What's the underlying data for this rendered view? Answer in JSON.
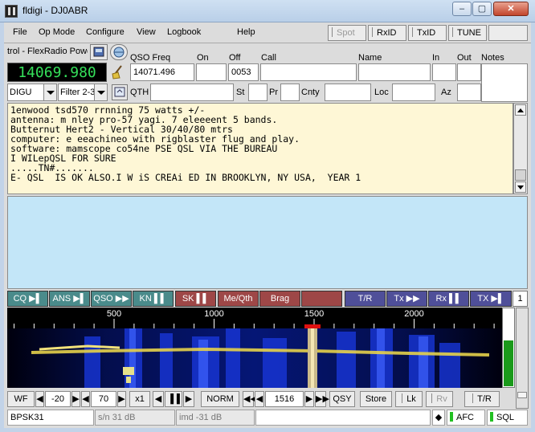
{
  "window": {
    "title": "fldigi - DJ0ABR",
    "minimize": "–",
    "maximize": "▢",
    "close": "✕"
  },
  "menu": {
    "file": "File",
    "opmode": "Op Mode",
    "configure": "Configure",
    "view": "View",
    "logbook": "Logbook",
    "help": "Help",
    "spot": "Spot",
    "rxid": "RxID",
    "txid": "TxID",
    "tune": "TUNE"
  },
  "rig": {
    "name": "trol - FlexRadio Powe",
    "frequency": "14069.980",
    "mode": "DIGU",
    "filter": "Filter 2-3"
  },
  "log": {
    "qso_freq_label": "QSO Freq",
    "qso_freq": "14071.496",
    "on_label": "On",
    "on": "",
    "off_label": "Off",
    "off": "0053",
    "call_label": "Call",
    "call": "",
    "name_label": "Name",
    "name": "",
    "in_label": "In",
    "in": "",
    "out_label": "Out",
    "out": "",
    "notes_label": "Notes",
    "notes": "",
    "qth_label": "QTH",
    "qth": "",
    "st_label": "St",
    "st": "",
    "pr_label": "Pr",
    "pr": "",
    "cnty_label": "Cnty",
    "cnty": "",
    "loc_label": "Loc",
    "loc": "",
    "az_label": "Az",
    "az": ""
  },
  "rx_text": "1enwood tsd570 rrnning 75 watts +/-\nantenna: m nley pro-57 yagi. 7 eleeeent 5 bands.\nButternut Hert2 - Vertical 30/40/80 mtrs\ncomputer: e eeachineo with rigblaster flug and play.\nsoftware: mamscope co54ne PSE QSL VIA THE BUREAU\nI WILepQSL FOR SURE\n.....TN#.......\nE- QSL  IS OK ALSO.I W iS CREAi ED IN BROOKLYN, NY USA,  YEAR 1",
  "tx_text": "",
  "macros": [
    {
      "label": "CQ ▶▌",
      "color": "teal"
    },
    {
      "label": "ANS ▶▌",
      "color": "teal"
    },
    {
      "label": "QSO ▶▶",
      "color": "teal"
    },
    {
      "label": "KN ▌▌",
      "color": "teal"
    },
    {
      "label": "SK ▌▌",
      "color": "red"
    },
    {
      "label": "Me/Qth",
      "color": "red"
    },
    {
      "label": "Brag",
      "color": "red"
    },
    {
      "label": "",
      "color": "red"
    },
    {
      "label": "T/R",
      "color": "blue"
    },
    {
      "label": "Tx ▶▶",
      "color": "blue"
    },
    {
      "label": "Rx ▌▌",
      "color": "blue"
    },
    {
      "label": "TX ▶▌",
      "color": "blue"
    }
  ],
  "macro_page": "1",
  "waterfall": {
    "scale_labels": [
      "500",
      "1000",
      "1500",
      "2000"
    ],
    "signal_level": 0.58
  },
  "controls": {
    "wf": "WF",
    "offset": "-20",
    "range": "70",
    "zoom": "x1",
    "pause": "▐▐",
    "norm": "NORM",
    "freq": "1516",
    "qsy": "QSY",
    "store": "Store",
    "lk": "Lk",
    "rv": "Rv",
    "tr": "T/R"
  },
  "status": {
    "mode": "BPSK31",
    "sn": "s/n 31 dB",
    "imd": "imd -31 dB",
    "message": "",
    "afc": "AFC",
    "sql": "SQL"
  }
}
